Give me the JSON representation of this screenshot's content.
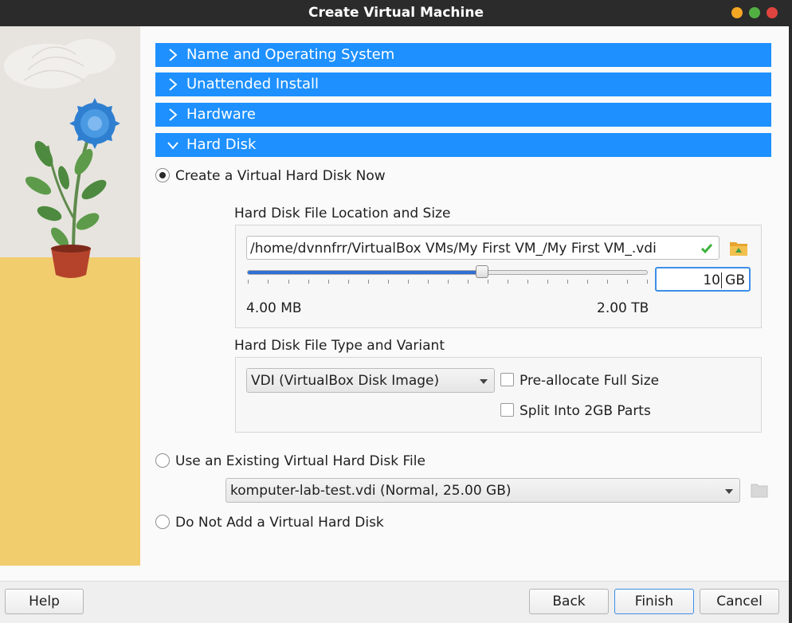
{
  "window": {
    "title": "Create Virtual Machine",
    "controls": {
      "minimize_color": "#f5a623",
      "maximize_color": "#52b043",
      "close_color": "#e0443e"
    }
  },
  "colors": {
    "accent": "#1e90ff",
    "slider_fill": "#2f6fd6",
    "side_floor": "#f2cd6e",
    "focus": "#3d8ee8"
  },
  "sections": [
    {
      "label": "Name and Operating System",
      "expanded": false,
      "icon": "chevron-right-icon"
    },
    {
      "label": "Unattended Install",
      "expanded": false,
      "icon": "chevron-right-icon"
    },
    {
      "label": "Hardware",
      "expanded": false,
      "icon": "chevron-right-icon"
    },
    {
      "label": "Hard Disk",
      "expanded": true,
      "icon": "chevron-down-icon"
    }
  ],
  "hard_disk": {
    "option_create": {
      "label": "Create a Virtual Hard Disk Now",
      "selected": true
    },
    "location_group": {
      "title": "Hard Disk File Location and Size",
      "path": "/home/dvnnfrr/VirtualBox VMs/My First VM_/My First VM_.vdi",
      "path_valid_icon": "checkmark-icon",
      "browse_icon": "folder-icon",
      "slider_fraction": 0.59,
      "size_value": "10",
      "size_unit": "GB",
      "min_label": "4.00 MB",
      "max_label": "2.00 TB"
    },
    "type_group": {
      "title": "Hard Disk File Type and Variant",
      "type_selected": "VDI (VirtualBox Disk Image)",
      "preallocate_label": "Pre-allocate Full Size",
      "preallocate_checked": false,
      "split_label": "Split Into 2GB Parts",
      "split_checked": false
    },
    "option_existing": {
      "label": "Use an Existing Virtual Hard Disk File",
      "selected": false,
      "file_selected": "komputer-lab-test.vdi (Normal, 25.00 GB)",
      "browse_icon": "folder-icon"
    },
    "option_none": {
      "label": "Do Not Add a Virtual Hard Disk",
      "selected": false
    }
  },
  "footer": {
    "help_label": "Help",
    "back_label": "Back",
    "finish_label": "Finish",
    "cancel_label": "Cancel"
  }
}
